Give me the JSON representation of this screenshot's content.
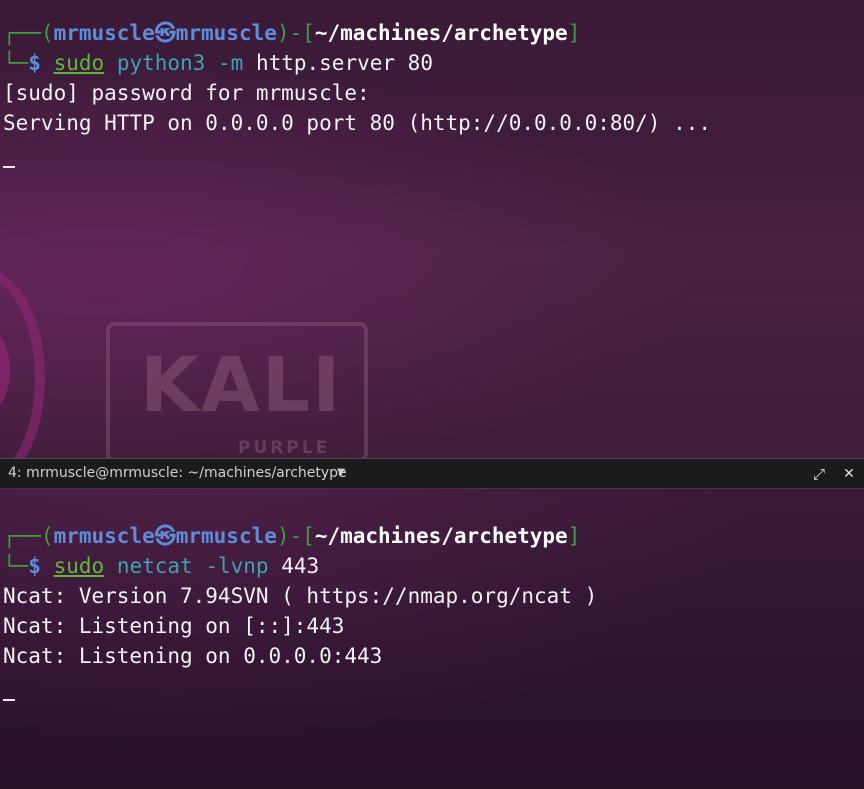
{
  "colors": {
    "frame": "#3f9f3a",
    "user": "#5f8cd6",
    "command_sudo": "#5fb83a",
    "command_main": "#3ea2b0",
    "text": "#f2f2f2",
    "tabbar_bg": "#1b1b1e"
  },
  "top_pane": {
    "prompt": {
      "frame_top": "┌──(",
      "user": "mrmuscle",
      "skull": "㉿",
      "host": "mrmuscle",
      "mid": ")-[",
      "path": "~/machines/archetype",
      "end": "]",
      "frame_bottom": "└─",
      "dollar": "$ "
    },
    "command": {
      "sudo": "sudo",
      "program": "python3",
      "flag": "-m",
      "args": "http.server 80"
    },
    "output": [
      "[sudo] password for mrmuscle:",
      "Serving HTTP on 0.0.0.0 port 80 (http://0.0.0.0:80/) ..."
    ]
  },
  "watermark": {
    "title": "KALI",
    "subtitle": "PURPLE"
  },
  "tabbar": {
    "title": "4: mrmuscle@mrmuscle: ~/machines/archetype",
    "dropdown_icon": "chevron-down-icon",
    "maximize_icon": "maximize-icon",
    "close_icon": "close-icon"
  },
  "bottom_pane": {
    "prompt": {
      "frame_top": "┌──(",
      "user": "mrmuscle",
      "skull": "㉿",
      "host": "mrmuscle",
      "mid": ")-[",
      "path": "~/machines/archetype",
      "end": "]",
      "frame_bottom": "└─",
      "dollar": "$ "
    },
    "command": {
      "sudo": "sudo",
      "program": "netcat",
      "flag": "-lvnp",
      "args": "443"
    },
    "output": [
      "Ncat: Version 7.94SVN ( https://nmap.org/ncat )",
      "Ncat: Listening on [::]:443",
      "Ncat: Listening on 0.0.0.0:443"
    ]
  }
}
